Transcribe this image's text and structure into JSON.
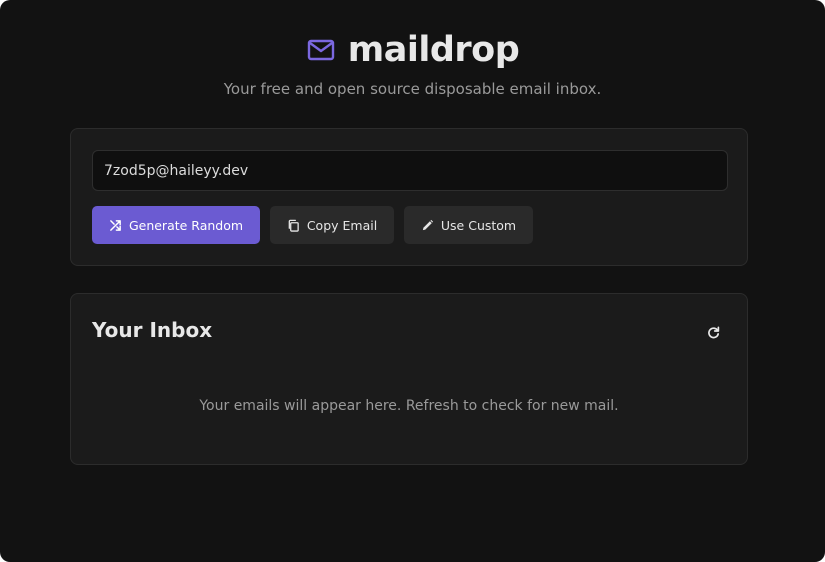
{
  "app": {
    "title": "maildrop",
    "tagline": "Your free and open source disposable email inbox.",
    "brand_icon": "envelope-icon",
    "accent_color": "#6b5bd2"
  },
  "generator": {
    "email_value": "7zod5p@haileyy.dev",
    "buttons": {
      "generate_label": "Generate Random",
      "generate_icon": "shuffle-icon",
      "copy_label": "Copy Email",
      "copy_icon": "copy-icon",
      "custom_label": "Use Custom",
      "custom_icon": "pencil-icon"
    }
  },
  "inbox": {
    "title": "Your Inbox",
    "refresh_icon": "refresh-icon",
    "empty_message": "Your emails will appear here. Refresh to check for new mail."
  }
}
